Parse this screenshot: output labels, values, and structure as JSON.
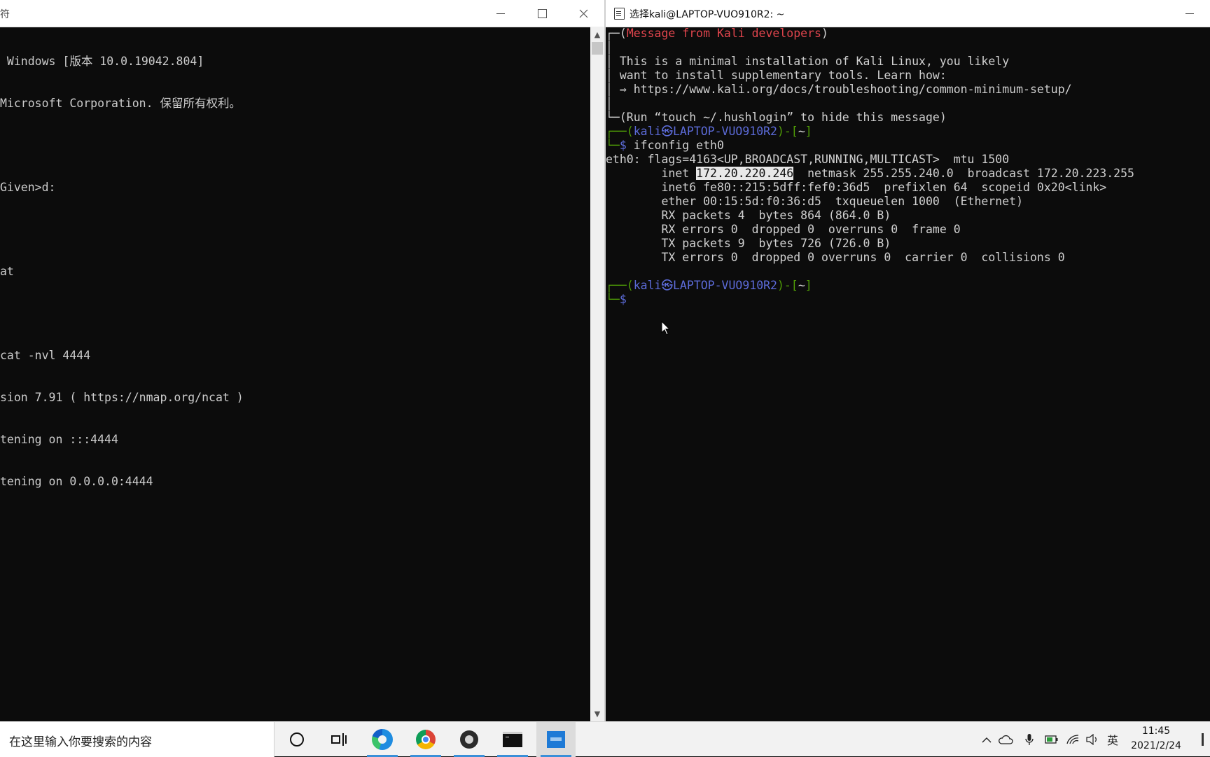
{
  "cmd": {
    "title": "符",
    "lines": [
      " Windows [版本 10.0.19042.804]",
      "Microsoft Corporation. 保留所有权利。",
      "",
      "Given>d:",
      "",
      "at",
      "",
      "cat -nvl 4444",
      "sion 7.91 ( https://nmap.org/ncat )",
      "tening on :::4444",
      "tening on 0.0.0.0:4444"
    ]
  },
  "kali": {
    "title": "选择kali@LAPTOP-VUO910R2: ~",
    "banner_heading": "Message from Kali developers",
    "banner_lines": [
      "This is a minimal installation of Kali Linux, you likely",
      "want to install supplementary tools. Learn how:",
      "⇒ https://www.kali.org/docs/troubleshooting/common-minimum-setup/"
    ],
    "hush_note": "(Run “touch ~/.hushlogin” to hide this message)",
    "prompt_user": "kali㉿LAPTOP-VUO910R2",
    "prompt_dir": "~",
    "prompt_symbol": "$",
    "command": "ifconfig eth0",
    "output": {
      "line1": "eth0: flags=4163<UP,BROADCAST,RUNNING,MULTICAST>  mtu 1500",
      "inet_prefix": "        inet ",
      "inet_addr": "172.20.220.246",
      "inet_suffix": "  netmask 255.255.240.0  broadcast 172.20.223.255",
      "lines": [
        "        inet6 fe80::215:5dff:fef0:36d5  prefixlen 64  scopeid 0x20<link>",
        "        ether 00:15:5d:f0:36:d5  txqueuelen 1000  (Ethernet)",
        "        RX packets 4  bytes 864 (864.0 B)",
        "        RX errors 0  dropped 0  overruns 0  frame 0",
        "        TX packets 9  bytes 726 (726.0 B)",
        "        TX errors 0  dropped 0 overruns 0  carrier 0  collisions 0"
      ]
    }
  },
  "taskbar": {
    "search_placeholder": "在这里输入你要搜索的内容",
    "ime": "英",
    "time": "11:45",
    "date": "2021/2/24"
  },
  "colors": {
    "terminal_bg": "#0c0c0c",
    "terminal_text": "#cccccc",
    "prompt_green": "#4e9a06",
    "prompt_blue": "#5c6bd8",
    "banner_red": "#e0454d",
    "taskbar_active": "#3a8fd8"
  }
}
